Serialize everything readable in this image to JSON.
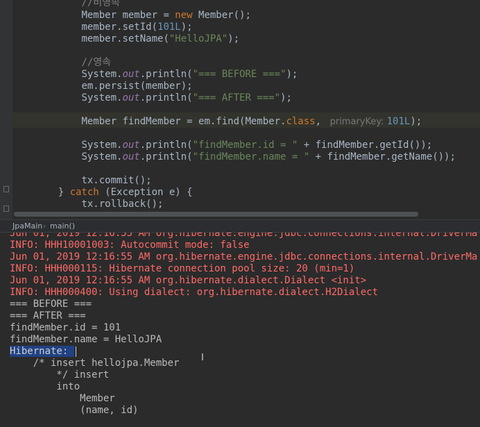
{
  "editor": {
    "lines": [
      {
        "indent": "        ",
        "parts": [
          {
            "t": "//비영속",
            "c": "cmt"
          }
        ]
      },
      {
        "indent": "        ",
        "parts": [
          {
            "t": "Member member = ",
            "c": ""
          },
          {
            "t": "new",
            "c": "kw"
          },
          {
            "t": " Member();",
            "c": ""
          }
        ]
      },
      {
        "indent": "        ",
        "parts": [
          {
            "t": "member.setId(",
            "c": ""
          },
          {
            "t": "101L",
            "c": "num"
          },
          {
            "t": ");",
            "c": ""
          }
        ]
      },
      {
        "indent": "        ",
        "parts": [
          {
            "t": "member.setName(",
            "c": ""
          },
          {
            "t": "\"HelloJPA\"",
            "c": "str"
          },
          {
            "t": ");",
            "c": ""
          }
        ]
      },
      {
        "indent": "",
        "parts": []
      },
      {
        "indent": "        ",
        "parts": [
          {
            "t": "//영속",
            "c": "cmt"
          }
        ]
      },
      {
        "indent": "        ",
        "parts": [
          {
            "t": "System.",
            "c": ""
          },
          {
            "t": "out",
            "c": "fld"
          },
          {
            "t": ".println(",
            "c": ""
          },
          {
            "t": "\"=== BEFORE ===\"",
            "c": "str"
          },
          {
            "t": ");",
            "c": ""
          }
        ]
      },
      {
        "indent": "        ",
        "parts": [
          {
            "t": "em.persist(member);",
            "c": ""
          }
        ]
      },
      {
        "indent": "        ",
        "parts": [
          {
            "t": "System.",
            "c": ""
          },
          {
            "t": "out",
            "c": "fld"
          },
          {
            "t": ".println(",
            "c": ""
          },
          {
            "t": "\"=== AFTER ===\"",
            "c": "str"
          },
          {
            "t": ");",
            "c": ""
          }
        ]
      },
      {
        "indent": "",
        "parts": []
      },
      {
        "indent": "        ",
        "parts": [
          {
            "t": "Member findMember = em.find(Member.",
            "c": ""
          },
          {
            "t": "class",
            "c": "kw"
          },
          {
            "t": ", ",
            "c": ""
          },
          {
            "t": " primaryKey: ",
            "c": "hint"
          },
          {
            "t": "101L",
            "c": "num"
          },
          {
            "t": ");",
            "c": ""
          }
        ]
      },
      {
        "indent": "",
        "parts": []
      },
      {
        "indent": "        ",
        "parts": [
          {
            "t": "System.",
            "c": ""
          },
          {
            "t": "out",
            "c": "fld"
          },
          {
            "t": ".println(",
            "c": ""
          },
          {
            "t": "\"findMember.id = \"",
            "c": "str"
          },
          {
            "t": " + findMember.getId());",
            "c": ""
          }
        ]
      },
      {
        "indent": "        ",
        "parts": [
          {
            "t": "System.",
            "c": ""
          },
          {
            "t": "out",
            "c": "fld"
          },
          {
            "t": ".println(",
            "c": ""
          },
          {
            "t": "\"findMember.name = \"",
            "c": "str"
          },
          {
            "t": " + findMember.getName());",
            "c": ""
          }
        ]
      },
      {
        "indent": "",
        "parts": []
      },
      {
        "indent": "        ",
        "parts": [
          {
            "t": "tx.commit();",
            "c": ""
          }
        ]
      },
      {
        "indent": "    ",
        "parts": [
          {
            "t": "} ",
            "c": ""
          },
          {
            "t": "catch",
            "c": "kw"
          },
          {
            "t": " (Exception e) {",
            "c": ""
          }
        ]
      },
      {
        "indent": "        ",
        "parts": [
          {
            "t": "tx.rollback();",
            "c": ""
          }
        ]
      }
    ]
  },
  "breadcrumb": {
    "file": "JpaMain",
    "method": "main()"
  },
  "console": {
    "lines": [
      {
        "t": "Jun 01, 2019 12:16:55 AM org.hibernate.engine.jdbc.connections.internal.DriverMa",
        "c": "err"
      },
      {
        "t": "INFO: HHH10001003: Autocommit mode: false",
        "c": "err"
      },
      {
        "t": "Jun 01, 2019 12:16:55 AM org.hibernate.engine.jdbc.connections.internal.DriverMa",
        "c": "err"
      },
      {
        "t": "INFO: HHH000115: Hibernate connection pool size: 20 (min=1)",
        "c": "err"
      },
      {
        "t": "Jun 01, 2019 12:16:55 AM org.hibernate.dialect.Dialect <init>",
        "c": "err"
      },
      {
        "t": "INFO: HHH000400: Using dialect: org.hibernate.dialect.H2Dialect",
        "c": "err"
      },
      {
        "t": "=== BEFORE ===",
        "c": "out"
      },
      {
        "t": "=== AFTER ===",
        "c": "out"
      },
      {
        "t": "findMember.id = 101",
        "c": "out"
      },
      {
        "t": "findMember.name = HelloJPA",
        "c": "out"
      },
      {
        "t": "Hibernate: ",
        "c": "sel"
      },
      {
        "t": "    /* insert hellojpa.Member",
        "c": "out"
      },
      {
        "t": "        */ insert",
        "c": "out"
      },
      {
        "t": "        into",
        "c": "out"
      },
      {
        "t": "            Member",
        "c": "out"
      },
      {
        "t": "            (name, id)",
        "c": "out"
      }
    ]
  }
}
